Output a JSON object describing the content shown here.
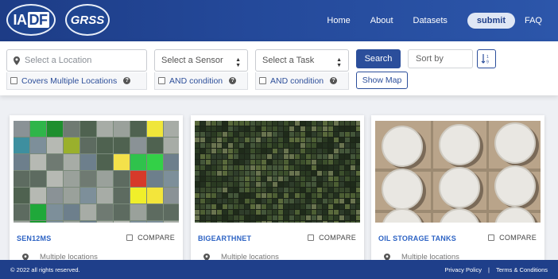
{
  "header": {
    "logo_left": "IADF",
    "logo_right": "GRSS",
    "nav": [
      "Home",
      "About",
      "Datasets",
      "submit",
      "FAQ"
    ]
  },
  "filters": {
    "location_placeholder": "Select a Location",
    "sensor_label": "Select a Sensor",
    "task_label": "Select a Task",
    "covers_multiple": "Covers Multiple Locations",
    "and_condition": "AND condition",
    "search_label": "Search",
    "show_map_label": "Show Map",
    "sort_by_label": "Sort by"
  },
  "cards": [
    {
      "name": "SEN12MS",
      "compare": "COMPARE",
      "location": "Multiple locations"
    },
    {
      "name": "BIGEARTHNET",
      "compare": "COMPARE",
      "location": "Multiple locations"
    },
    {
      "name": "OIL STORAGE TANKS",
      "compare": "COMPARE",
      "location": "Multiple locations"
    }
  ],
  "footer": {
    "copyright": "© 2022 all rights reserved.",
    "privacy": "Privacy Policy",
    "separator": "|",
    "terms": "Terms & Conditions"
  },
  "colors": {
    "header_bg": "#24499a",
    "accent": "#2b4e9b",
    "card_title": "#2d63c4",
    "footer_bg": "#1f3f8a"
  }
}
